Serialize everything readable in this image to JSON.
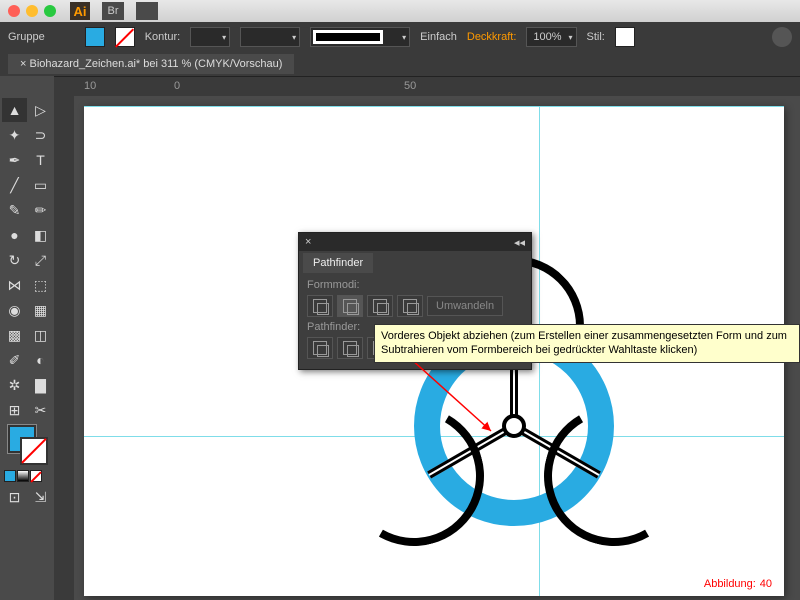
{
  "titlebar": {
    "app": "Ai",
    "br": "Br"
  },
  "controlbar": {
    "group": "Gruppe",
    "stroke_label": "Kontur:",
    "stroke_style": "Einfach",
    "opacity_label": "Deckkraft:",
    "opacity_value": "100%",
    "style_label": "Stil:"
  },
  "tab": {
    "title": "Biohazard_Zeichen.ai* bei 311 % (CMYK/Vorschau)"
  },
  "ruler": {
    "m10": "10",
    "m0": "0",
    "m50": "50"
  },
  "panel": {
    "title": "Pathfinder",
    "section1": "Formmodi:",
    "convert": "Umwandeln",
    "section2": "Pathfinder:"
  },
  "tooltip": {
    "text": "Vorderes Objekt abziehen (zum Erstellen einer zusammengesetzten Form und zum Subtrahieren vom Formbereich bei gedrückter Wahltaste klicken)"
  },
  "caption": {
    "label": "Abbildung:",
    "num": "40"
  },
  "colors": {
    "accent": "#29abe2"
  }
}
